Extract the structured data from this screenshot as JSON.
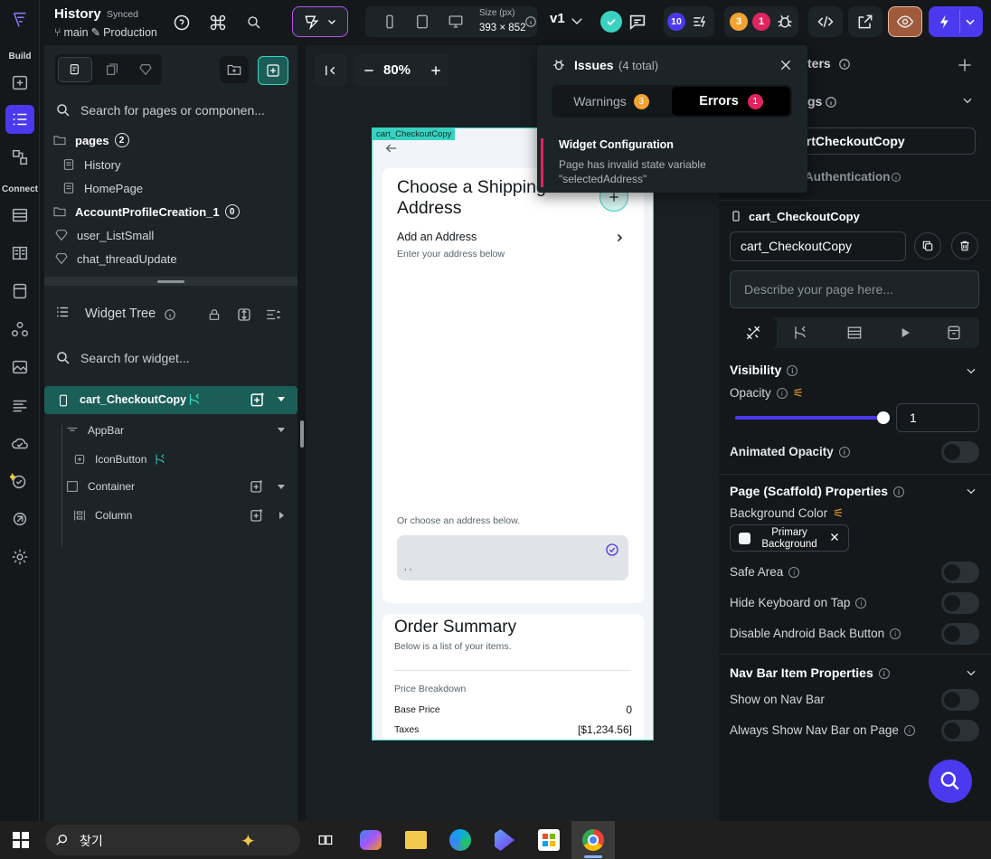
{
  "app": {
    "project_name": "History",
    "sync_status": "Synced",
    "branch": "main",
    "environment": "Production",
    "size_label": "Size (px)",
    "size_value": "393 × 852",
    "version": "v1",
    "comments_count": "10",
    "warnings_count": "3",
    "errors_count": "1"
  },
  "rail": {
    "build_label": "Build",
    "connect_label": "Connect"
  },
  "pages_panel": {
    "search_placeholder": "Search for pages or componen...",
    "pages_folder": "pages",
    "pages_count": "2",
    "pages": [
      "History",
      "HomePage"
    ],
    "folder2": "AccountProfileCreation_1",
    "folder2_count": "0",
    "components": [
      "user_ListSmall",
      "chat_threadUpdate"
    ]
  },
  "widget_tree": {
    "title": "Widget Tree",
    "search_placeholder": "Search for widget...",
    "root": "cart_CheckoutCopy",
    "items": [
      "AppBar",
      "IconButton",
      "Container",
      "Column"
    ]
  },
  "canvas": {
    "zoom": "80%",
    "page_tag": "cart_CheckoutCopy",
    "shipping_title": "Choose a Shipping Address",
    "add_address": "Add an Address",
    "enter_address": "Enter your address below",
    "or_choose": "Or choose an address below.",
    "address_value": ", ,",
    "order_summary": "Order Summary",
    "order_sub": "Below is a list of your items.",
    "price_breakdown": "Price Breakdown",
    "base_price_label": "Base Price",
    "base_price_value": "0",
    "taxes_label": "Taxes",
    "taxes_value": "[$1,234.56]"
  },
  "issues": {
    "title": "Issues",
    "total": "(4 total)",
    "tab_warnings": "Warnings",
    "warnings_count": "3",
    "tab_errors": "Errors",
    "errors_count": "1",
    "error_title": "Widget Configuration",
    "error_desc": "Page has invalid state variable \"selectedAddress\""
  },
  "right_panel": {
    "params_title_partial": "ters",
    "settings_partial": "gs",
    "page_name_partial": "artCheckoutCopy",
    "auth_partial": "Authentication",
    "widget_name": "cart_CheckoutCopy",
    "name_input": "cart_CheckoutCopy",
    "description_placeholder": "Describe your page here...",
    "visibility": "Visibility",
    "opacity": "Opacity",
    "opacity_value": "1",
    "opacity_fraction": 1.0,
    "animated_opacity": "Animated Opacity",
    "scaffold_title": "Page (Scaffold) Properties",
    "bg_color_label": "Background Color",
    "bg_color_value": "Primary Background",
    "safe_area": "Safe Area",
    "hide_keyboard": "Hide Keyboard on Tap",
    "disable_back": "Disable Android Back Button",
    "nav_bar_title": "Nav Bar Item Properties",
    "show_nav_bar": "Show on Nav Bar",
    "always_show_nav": "Always Show Nav Bar on Page"
  },
  "taskbar": {
    "search_text": "찾기"
  },
  "colors": {
    "accent": "#4b39ef",
    "teal": "#39d2c0",
    "warning": "#f2a231",
    "error": "#e0245e"
  }
}
